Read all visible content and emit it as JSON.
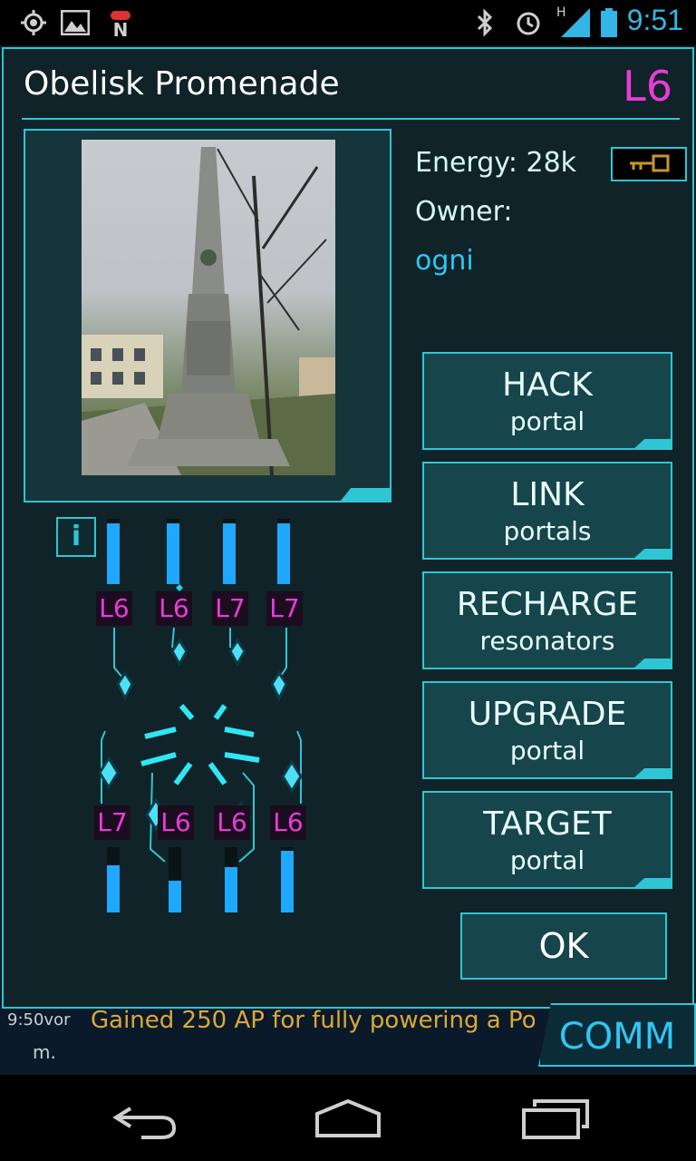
{
  "status_bar": {
    "time": "9:51",
    "network_label": "H",
    "icons": [
      "gps-icon",
      "image-icon",
      "android-n-icon",
      "bluetooth-icon",
      "alarm-icon",
      "signal-icon",
      "battery-icon"
    ]
  },
  "portal": {
    "name": "Obelisk Promenade",
    "level": "L6",
    "energy_label": "Energy:  28k",
    "owner_label": "Owner:",
    "owner_name": "ogni",
    "info_label": "i"
  },
  "actions": [
    {
      "main": "HACK",
      "sub": "portal"
    },
    {
      "main": "LINK",
      "sub": "portals"
    },
    {
      "main": "RECHARGE",
      "sub": "resonators"
    },
    {
      "main": "UPGRADE",
      "sub": "portal"
    },
    {
      "main": "TARGET",
      "sub": "portal"
    }
  ],
  "ok_label": "OK",
  "resonators": {
    "top": [
      {
        "level": "L6",
        "fill": 0.93
      },
      {
        "level": "L6",
        "fill": 0.93
      },
      {
        "level": "L7",
        "fill": 0.93
      },
      {
        "level": "L7",
        "fill": 0.93
      }
    ],
    "bottom": [
      {
        "level": "L7",
        "fill": 0.72
      },
      {
        "level": "L6",
        "fill": 0.48
      },
      {
        "level": "L6",
        "fill": 0.7
      },
      {
        "level": "L6",
        "fill": 0.95
      }
    ]
  },
  "comm": {
    "label": "COMM",
    "message": "Gained 250 AP for fully powering a Po",
    "time": "9:50vor",
    "trailing": "m."
  },
  "colors": {
    "accent": "#2fc6d4",
    "level": "#e83cd8",
    "owner": "#2fc6f4",
    "bar": "#1ea8ff"
  }
}
